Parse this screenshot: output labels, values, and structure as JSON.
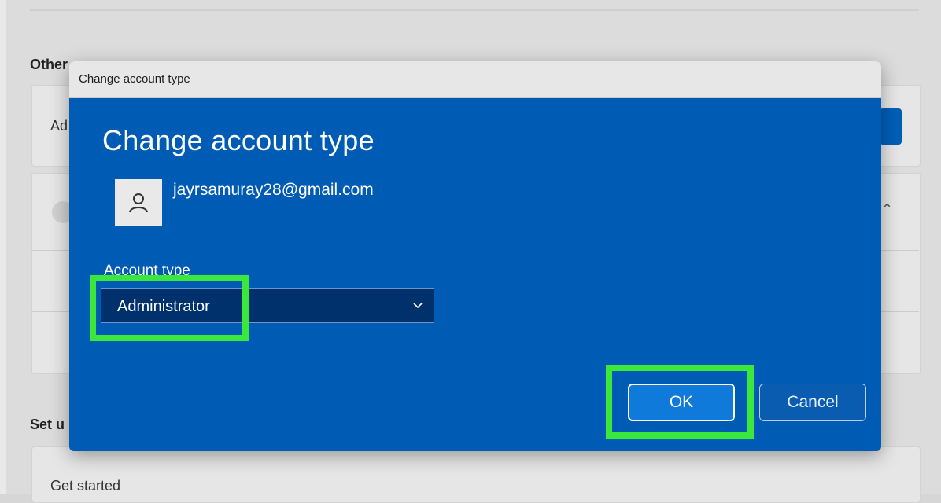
{
  "background": {
    "section_other_label": "Other",
    "card_add_label": "Ad",
    "section_setup_label": "Set u",
    "get_started_label": "Get started"
  },
  "dialog": {
    "window_title": "Change account type",
    "heading": "Change account type",
    "user": {
      "email": "jayrsamuray28@gmail.com",
      "icon": "person-icon"
    },
    "account_type": {
      "label": "Account type",
      "selected_value": "Administrator",
      "icon": "chevron-down-icon"
    },
    "buttons": {
      "ok_label": "OK",
      "cancel_label": "Cancel"
    }
  },
  "colors": {
    "dialog_background": "#005bb5",
    "highlight": "#39e83a",
    "select_background": "#00316c"
  }
}
